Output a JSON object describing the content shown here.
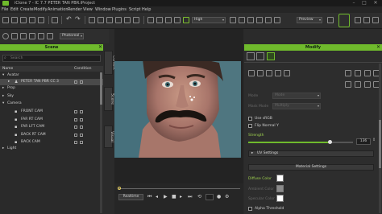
{
  "window": {
    "title": "iClone 7 - IC 7.7 PETER TAN PBR.iProject",
    "min_glyph": "–",
    "max_glyph": "□",
    "close_glyph": "✕"
  },
  "menu": {
    "items": [
      "File",
      "Edit",
      "Create",
      "Modify",
      "Animation",
      "Render",
      "View",
      "Window",
      "Plugins",
      "Script",
      "Help"
    ]
  },
  "toolbar": {
    "quality_select": "High",
    "preview_select": "Preview",
    "camera_select": "Photoreal"
  },
  "scene": {
    "header": "Scene",
    "close_glyph": "✕",
    "search_placeholder": "Search",
    "col_name": "Name",
    "col_condition": "Condition",
    "rows": [
      {
        "label": "Avatar",
        "depth": 0,
        "selected": false
      },
      {
        "label": "PETER TAN PBR CC 3",
        "depth": 1,
        "selected": true
      },
      {
        "label": "Prop",
        "depth": 0,
        "selected": false
      },
      {
        "label": "Sky",
        "depth": 0,
        "selected": false
      },
      {
        "label": "Camera",
        "depth": 0,
        "selected": false
      },
      {
        "label": "FRONT CAM",
        "depth": 1,
        "selected": false
      },
      {
        "label": "FAR RT CAM",
        "depth": 1,
        "selected": false
      },
      {
        "label": "FAR LFT CAM",
        "depth": 1,
        "selected": false
      },
      {
        "label": "BACK RT CAM",
        "depth": 1,
        "selected": false
      },
      {
        "label": "BACK CAM",
        "depth": 1,
        "selected": false
      },
      {
        "label": "Light",
        "depth": 0,
        "selected": false
      }
    ]
  },
  "side_tabs": {
    "content": "Content",
    "scene": "Scene",
    "visual": "Visual"
  },
  "timeline": {
    "realtime_label": "Realtime"
  },
  "modify": {
    "header": "Modify",
    "close_glyph": "✕",
    "field_a_label": "Mode",
    "field_a_value": "Mode",
    "field_b_label": "Mask Mode",
    "field_b_value": "Multiply",
    "use_srgb": "Use sRGB",
    "flip_normal": "Flip Normal Y",
    "strength_label": "Strength",
    "strength_value": "136",
    "strength_fraction": 0.78,
    "uv_settings": "UV Settings",
    "material_settings": "Material Settings",
    "diffuse_label": "Diffuse Color",
    "ambient_label": "Ambient Color",
    "specular_label": "Specular Color",
    "alpha_threshold": "Alpha Threshold",
    "colors": {
      "diffuse": "#ffffff",
      "ambient": "#8a8a8a",
      "specular": "#ffffff",
      "accent": "#6fba2c"
    }
  }
}
